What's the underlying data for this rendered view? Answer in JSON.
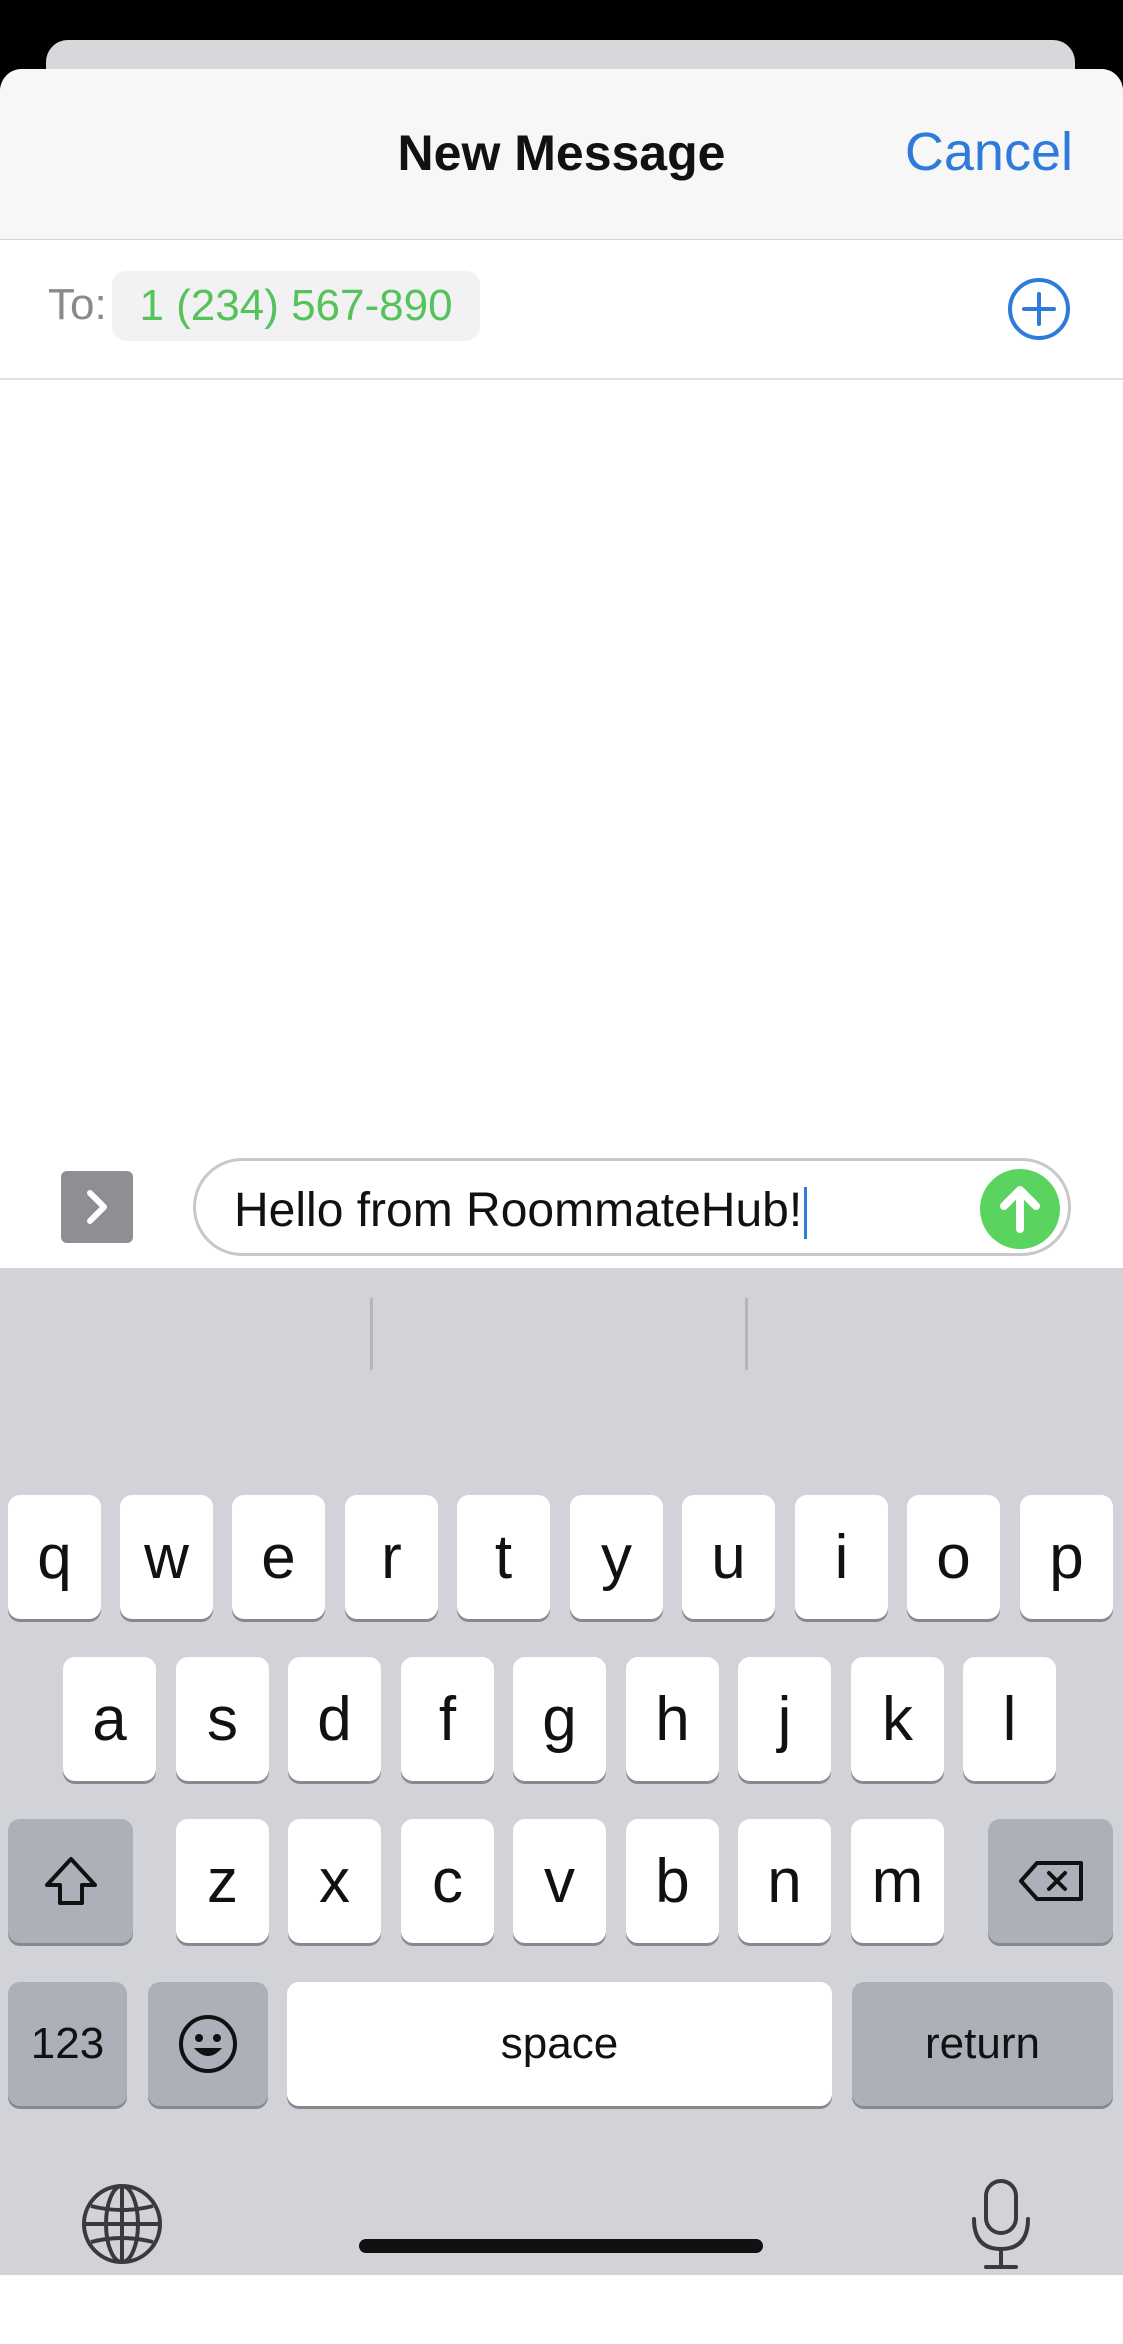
{
  "header": {
    "title": "New Message",
    "cancel_label": "Cancel"
  },
  "recipient": {
    "label": "To:",
    "number": "1 (234) 567-890"
  },
  "composer": {
    "message_text": "Hello from RoommateHub!"
  },
  "keyboard": {
    "row1": [
      "q",
      "w",
      "e",
      "r",
      "t",
      "y",
      "u",
      "i",
      "o",
      "p"
    ],
    "row2": [
      "a",
      "s",
      "d",
      "f",
      "g",
      "h",
      "j",
      "k",
      "l"
    ],
    "row3": [
      "z",
      "x",
      "c",
      "v",
      "b",
      "n",
      "m"
    ],
    "numbers_label": "123",
    "space_label": "space",
    "return_label": "return"
  },
  "icons": {
    "add_recipient": "plus-circle-icon",
    "apps": "chevron-right-icon",
    "send": "arrow-up-icon",
    "shift": "shift-icon",
    "delete": "backspace-icon",
    "emoji": "emoji-icon",
    "globe": "globe-icon",
    "dictation": "microphone-icon"
  },
  "colors": {
    "accent_blue": "#2f7bdc",
    "recipient_green": "#56c25a",
    "send_green": "#5bd35f",
    "keyboard_bg": "#d2d3d8"
  }
}
